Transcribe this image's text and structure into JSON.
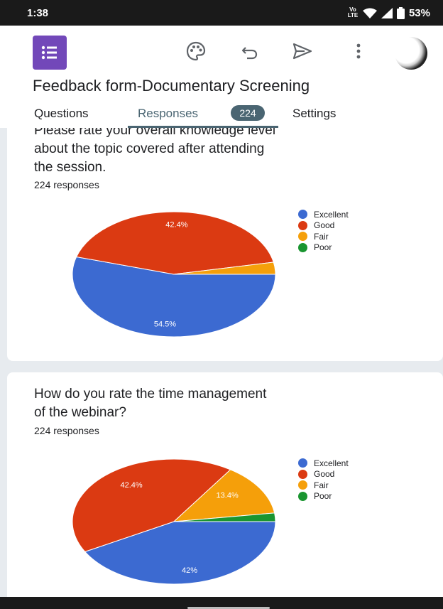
{
  "status": {
    "time": "1:38",
    "volte": "Vo LTE",
    "battery": "53%"
  },
  "app_bar": {
    "icons": [
      "forms-logo-icon",
      "palette-icon",
      "undo-icon",
      "send-icon",
      "more-vert-icon"
    ]
  },
  "form": {
    "title": "Feedback form-Documentary Screening"
  },
  "tabs": {
    "questions": "Questions",
    "responses": "Responses",
    "responses_count": "224",
    "settings": "Settings"
  },
  "colors": {
    "excellent": "#3c6ad1",
    "good": "#db3a12",
    "fair": "#f59f0a",
    "poor": "#1a9530"
  },
  "questions": [
    {
      "text_line1": "Please rate your overall knowledge level",
      "text_line2": "about the topic covered after attending",
      "text_line3": "the session.",
      "responses": "224 responses"
    },
    {
      "text_line1": "How do you rate the time management",
      "text_line2": "of the webinar?",
      "responses": "224 responses"
    }
  ],
  "chart_data": [
    {
      "type": "pie",
      "categories": [
        "Excellent",
        "Good",
        "Fair",
        "Poor"
      ],
      "values": [
        54.5,
        42.4,
        3.1,
        0
      ],
      "labels": [
        "54.5%",
        "42.4%",
        "",
        ""
      ],
      "legend": [
        "Excellent",
        "Good",
        "Fair",
        "Poor"
      ],
      "legend_position": "right"
    },
    {
      "type": "pie",
      "categories": [
        "Excellent",
        "Good",
        "Fair",
        "Poor"
      ],
      "values": [
        42,
        42.4,
        13.4,
        2.2
      ],
      "labels": [
        "42%",
        "42.4%",
        "13.4%",
        ""
      ],
      "legend": [
        "Excellent",
        "Good",
        "Fair",
        "Poor"
      ],
      "legend_position": "right"
    }
  ]
}
